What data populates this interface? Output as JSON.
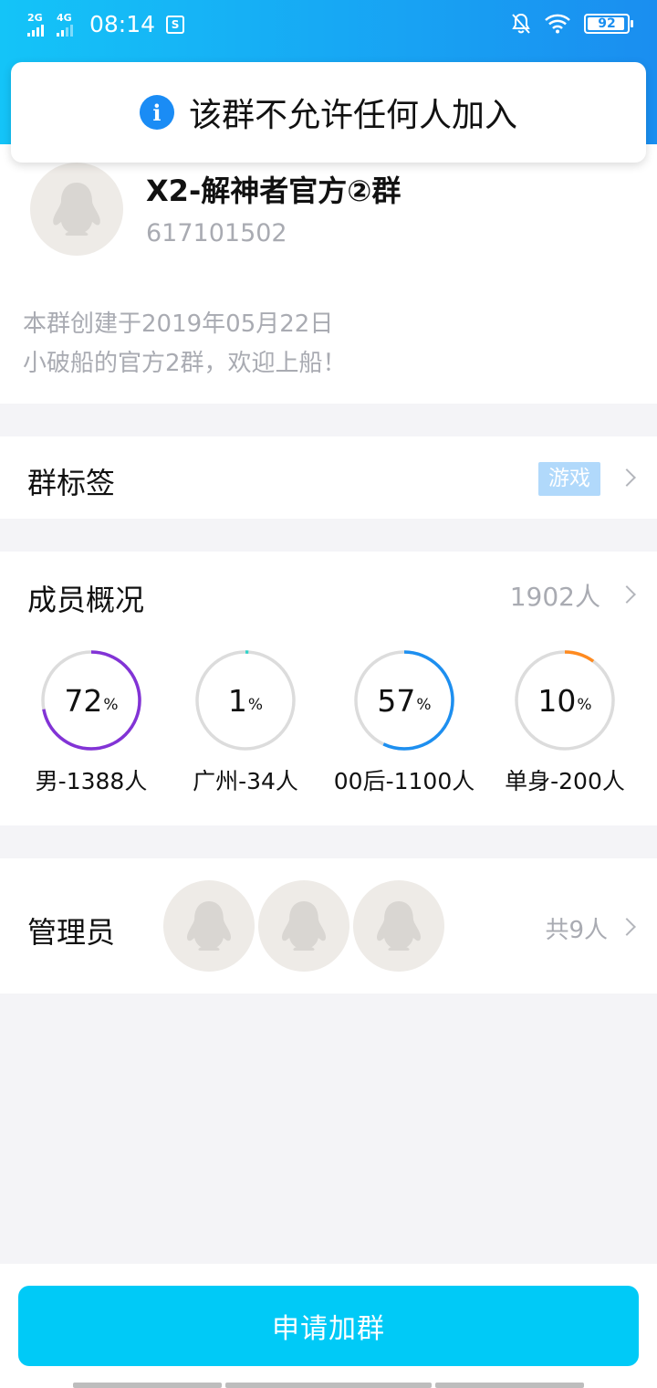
{
  "status_bar": {
    "signal1": "2G",
    "signal2": "4G",
    "time": "08:14",
    "notification_icon": "S",
    "battery": "92",
    "icons": [
      "bell-off-icon",
      "wifi-icon",
      "battery-icon"
    ]
  },
  "toast": {
    "icon": "info-icon",
    "message": "该群不允许任何人加入"
  },
  "group": {
    "name": "X2-解神者官方②群",
    "id": "617101502",
    "created": "本群创建于2019年05月22日",
    "description": "小破船的官方2群，欢迎上船！"
  },
  "tags": {
    "title": "群标签",
    "badge": "游戏"
  },
  "members": {
    "title": "成员概况",
    "count": "1902人",
    "stats": [
      {
        "num": "72",
        "pct": "%",
        "label": "男-1388人",
        "value": 72,
        "color": "#8233d6"
      },
      {
        "num": "1",
        "pct": "%",
        "label": "广州-34人",
        "value": 1,
        "color": "#2fd3c9"
      },
      {
        "num": "57",
        "pct": "%",
        "label": "00后-1100人",
        "value": 57,
        "color": "#1d8ff0"
      },
      {
        "num": "10",
        "pct": "%",
        "label": "单身-200人",
        "value": 10,
        "color": "#ff8a1f"
      }
    ]
  },
  "admins": {
    "title": "管理员",
    "count": "共9人"
  },
  "join_button": "申请加群",
  "colors": {
    "header_start": "#14c4f8",
    "header_end": "#1a8ef0",
    "button": "#00caf7",
    "secondary_text": "#a9abb2"
  }
}
